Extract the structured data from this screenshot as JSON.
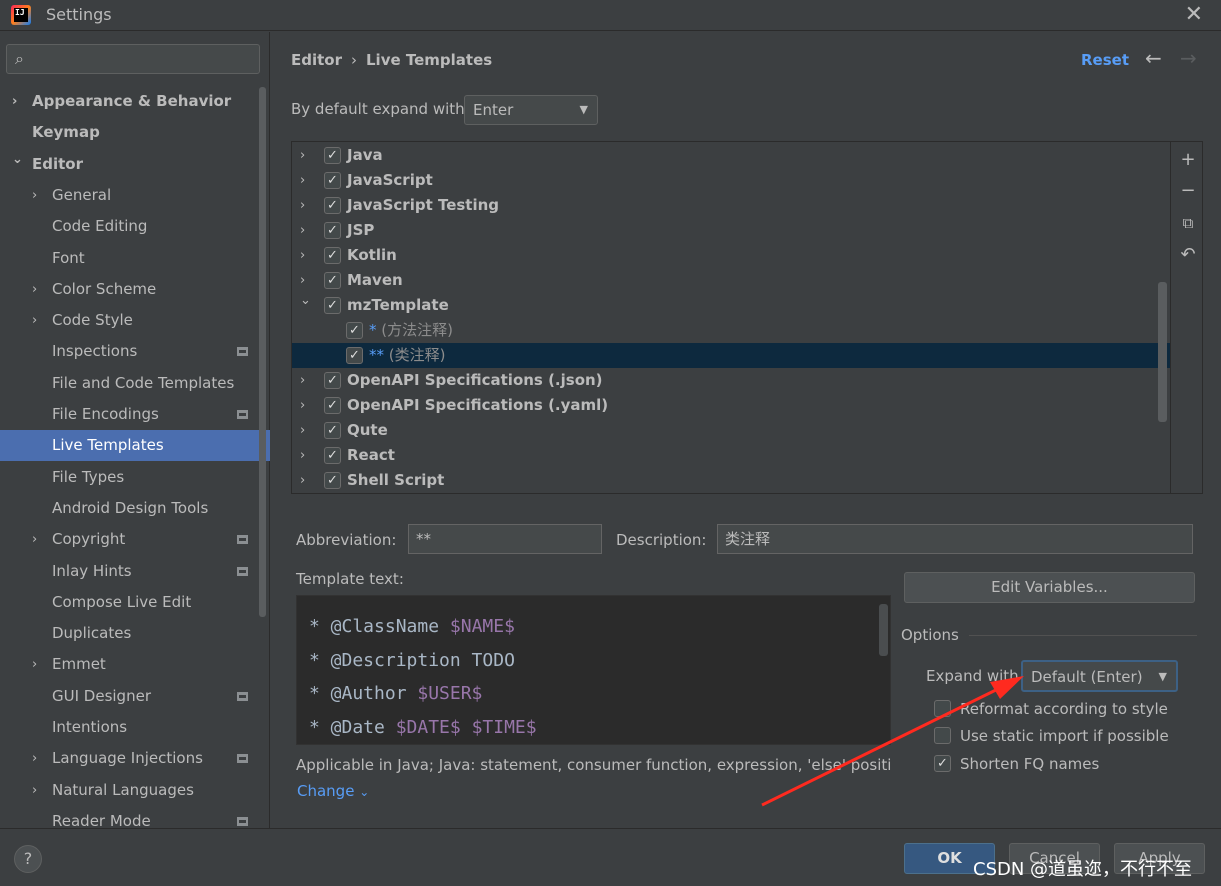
{
  "window": {
    "title": "Settings",
    "app_icon_text": "IJ"
  },
  "sidebar": {
    "search_placeholder": "",
    "items": [
      {
        "label": "Appearance & Behavior",
        "bold": true,
        "arrow": "›",
        "level": 0
      },
      {
        "label": "Keymap",
        "bold": true,
        "arrow": "",
        "level": 0
      },
      {
        "label": "Editor",
        "bold": true,
        "arrow": "⌄",
        "level": 0
      },
      {
        "label": "General",
        "arrow": "›",
        "level": 1
      },
      {
        "label": "Code Editing",
        "arrow": "",
        "level": 1
      },
      {
        "label": "Font",
        "arrow": "",
        "level": 1
      },
      {
        "label": "Color Scheme",
        "arrow": "›",
        "level": 1
      },
      {
        "label": "Code Style",
        "arrow": "›",
        "level": 1
      },
      {
        "label": "Inspections",
        "arrow": "",
        "level": 1,
        "project": true
      },
      {
        "label": "File and Code Templates",
        "arrow": "",
        "level": 1
      },
      {
        "label": "File Encodings",
        "arrow": "",
        "level": 1,
        "project": true
      },
      {
        "label": "Live Templates",
        "arrow": "",
        "level": 1,
        "selected": true
      },
      {
        "label": "File Types",
        "arrow": "",
        "level": 1
      },
      {
        "label": "Android Design Tools",
        "arrow": "",
        "level": 1
      },
      {
        "label": "Copyright",
        "arrow": "›",
        "level": 1,
        "project": true
      },
      {
        "label": "Inlay Hints",
        "arrow": "",
        "level": 1,
        "project": true
      },
      {
        "label": "Compose Live Edit",
        "arrow": "",
        "level": 1
      },
      {
        "label": "Duplicates",
        "arrow": "",
        "level": 1
      },
      {
        "label": "Emmet",
        "arrow": "›",
        "level": 1
      },
      {
        "label": "GUI Designer",
        "arrow": "",
        "level": 1,
        "project": true
      },
      {
        "label": "Intentions",
        "arrow": "",
        "level": 1
      },
      {
        "label": "Language Injections",
        "arrow": "›",
        "level": 1,
        "project": true
      },
      {
        "label": "Natural Languages",
        "arrow": "›",
        "level": 1
      },
      {
        "label": "Reader Mode",
        "arrow": "",
        "level": 1,
        "project": true
      }
    ]
  },
  "header": {
    "breadcrumb": [
      "Editor",
      "Live Templates"
    ],
    "breadcrumb_sep": "›",
    "reset": "Reset",
    "back": "←",
    "forward": "→"
  },
  "expand": {
    "label": "By default expand with",
    "value": "Enter"
  },
  "templates": [
    {
      "label": "Java",
      "type": "group",
      "checked": true,
      "expanded": false
    },
    {
      "label": "JavaScript",
      "type": "group",
      "checked": true,
      "expanded": false
    },
    {
      "label": "JavaScript Testing",
      "type": "group",
      "checked": true,
      "expanded": false
    },
    {
      "label": "JSP",
      "type": "group",
      "checked": true,
      "expanded": false
    },
    {
      "label": "Kotlin",
      "type": "group",
      "checked": true,
      "expanded": false
    },
    {
      "label": "Maven",
      "type": "group",
      "checked": true,
      "expanded": false
    },
    {
      "label": "mzTemplate",
      "type": "group",
      "checked": true,
      "expanded": true
    },
    {
      "abbr": "*",
      "desc": " (方法注释)",
      "type": "item",
      "checked": true
    },
    {
      "abbr": "**",
      "desc": " (类注释)",
      "type": "item",
      "checked": true,
      "selected": true
    },
    {
      "label": "OpenAPI Specifications (.json)",
      "type": "group",
      "checked": true,
      "expanded": false
    },
    {
      "label": "OpenAPI Specifications (.yaml)",
      "type": "group",
      "checked": true,
      "expanded": false
    },
    {
      "label": "Qute",
      "type": "group",
      "checked": true,
      "expanded": false
    },
    {
      "label": "React",
      "type": "group",
      "checked": true,
      "expanded": false
    },
    {
      "label": "Shell Script",
      "type": "group",
      "checked": true,
      "expanded": false
    }
  ],
  "toolbar": {
    "add": "+",
    "remove": "−",
    "copy": "⧉",
    "restore": "↶"
  },
  "details": {
    "abbreviation_label": "Abbreviation:",
    "abbreviation_value": "**",
    "description_label": "Description:",
    "description_value": "类注释",
    "template_text_label": "Template text:",
    "code_lines": [
      [
        {
          "t": "* @ClassName "
        },
        {
          "t": "$NAME$",
          "v": true
        }
      ],
      [
        {
          "t": "* @Description TODO"
        }
      ],
      [
        {
          "t": "* @Author "
        },
        {
          "t": "$USER$",
          "v": true
        }
      ],
      [
        {
          "t": "* @Date "
        },
        {
          "t": "$DATE$",
          "v": true
        },
        {
          "t": " "
        },
        {
          "t": "$TIME$",
          "v": true
        }
      ]
    ],
    "edit_variables": "Edit Variables...",
    "options_title": "Options",
    "expand_with_label": "Expand with",
    "expand_with_value": "Default (Enter)",
    "reformat": "Reformat according to style",
    "static_import": "Use static import if possible",
    "shorten_fq": "Shorten FQ names",
    "applicable": "Applicable in Java; Java: statement, consumer function, expression, 'else' position,...",
    "change": "Change"
  },
  "options_state": {
    "reformat": false,
    "static_import": false,
    "shorten_fq": true
  },
  "bottom": {
    "help": "?",
    "ok": "OK",
    "cancel": "Cancel",
    "apply": "Apply"
  },
  "watermark": "CSDN @道虽迩，不行不至",
  "colors": {
    "background": "#3c3f41",
    "selection": "#4b6eaf",
    "link": "#589df6",
    "editor_bg": "#2b2b2b",
    "template_var": "#9876aa",
    "annotation": "#ff2a1f"
  }
}
